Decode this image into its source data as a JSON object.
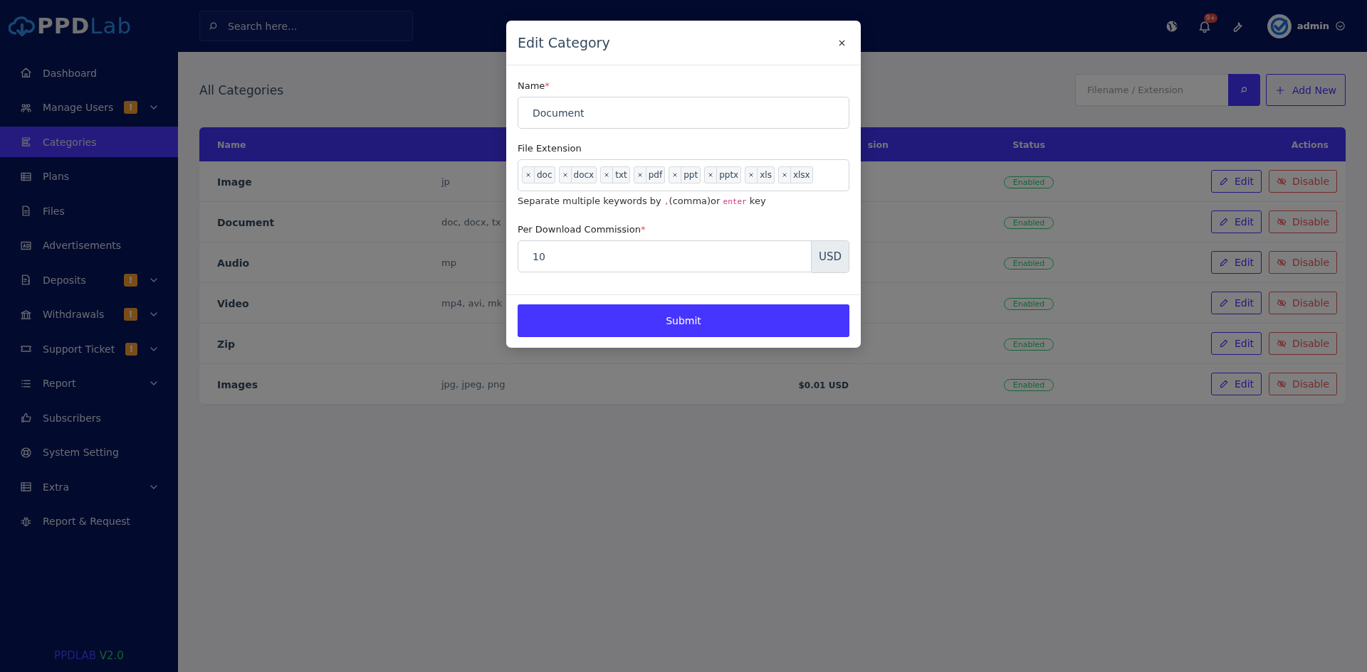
{
  "sidebar": {
    "logo": {
      "bold": "PPD",
      "light": "Lab"
    },
    "items": [
      {
        "label": "Dashboard",
        "selected": false,
        "has_submenu": false
      },
      {
        "label": "Manage Users",
        "selected": false,
        "has_submenu": true,
        "badge": "!"
      },
      {
        "label": "Categories",
        "selected": true,
        "has_submenu": false
      },
      {
        "label": "Plans",
        "selected": false,
        "has_submenu": false
      },
      {
        "label": "Files",
        "selected": false,
        "has_submenu": false
      },
      {
        "label": "Advertisements",
        "selected": false,
        "has_submenu": false
      },
      {
        "label": "Deposits",
        "selected": false,
        "has_submenu": true,
        "badge": "!"
      },
      {
        "label": "Withdrawals",
        "selected": false,
        "has_submenu": true,
        "badge": "!"
      },
      {
        "label": "Support Ticket",
        "selected": false,
        "has_submenu": true,
        "badge": "!"
      },
      {
        "label": "Report",
        "selected": false,
        "has_submenu": true
      },
      {
        "label": "Subscribers",
        "selected": false,
        "has_submenu": false
      },
      {
        "label": "System Setting",
        "selected": false,
        "has_submenu": false
      },
      {
        "label": "Extra",
        "selected": false,
        "has_submenu": true
      },
      {
        "label": "Report & Request",
        "selected": false,
        "has_submenu": false
      }
    ],
    "footer": {
      "brand": "PPDLAB",
      "version": "V2.0"
    }
  },
  "topbar": {
    "search": {
      "placeholder": "Search here..."
    },
    "notification_count": "9+",
    "user": "admin"
  },
  "page": {
    "title": "All Categories",
    "filter": {
      "placeholder": "Filename / Extension"
    },
    "add_button": "Add New"
  },
  "table": {
    "columns": {
      "name": "Name",
      "column_3": "sion",
      "status": "Status",
      "actions": "Actions"
    },
    "rows": [
      {
        "name": "Image",
        "column_2": "jp",
        "status": "Enabled",
        "actions": [
          "Edit",
          "Disable"
        ]
      },
      {
        "name": "Document",
        "column_2": "doc, docx, tx",
        "status": "Enabled",
        "actions": [
          "Edit",
          "Disable"
        ]
      },
      {
        "name": "Audio",
        "column_2": "mp",
        "status": "Enabled",
        "actions": [
          "Edit",
          "Disable"
        ]
      },
      {
        "name": "Video",
        "column_2": "mp4, avi, mk",
        "status": "Enabled",
        "actions": [
          "Edit",
          "Disable"
        ]
      },
      {
        "name": "Zip",
        "status": "Enabled",
        "actions": [
          "Edit",
          "Disable"
        ]
      },
      {
        "name": "Images",
        "column_2": "jpg, jpeg, png",
        "column_3": "$0.01 USD",
        "status": "Enabled",
        "actions": [
          "Edit",
          "Disable"
        ]
      }
    ]
  },
  "modal": {
    "title": "Edit Category",
    "name_field": {
      "label": "Name",
      "required_mark": "*",
      "value": "Document"
    },
    "extension_field": {
      "label": "File Extension",
      "tags": [
        "doc",
        "docx",
        "txt",
        "pdf",
        "ppt",
        "pptx",
        "xls",
        "xlsx"
      ],
      "help": [
        {
          "kind": "text",
          "text": "Separate multiple keywords by"
        },
        {
          "kind": "code",
          "text": ","
        },
        {
          "kind": "text",
          "text": "(comma)or"
        },
        {
          "kind": "code",
          "text": "enter"
        },
        {
          "kind": "text",
          "text": "key"
        }
      ]
    },
    "commission_field": {
      "label": "Per Download Commission",
      "required_mark": "*",
      "value": "10",
      "unit": "USD"
    },
    "submit": "Submit"
  }
}
